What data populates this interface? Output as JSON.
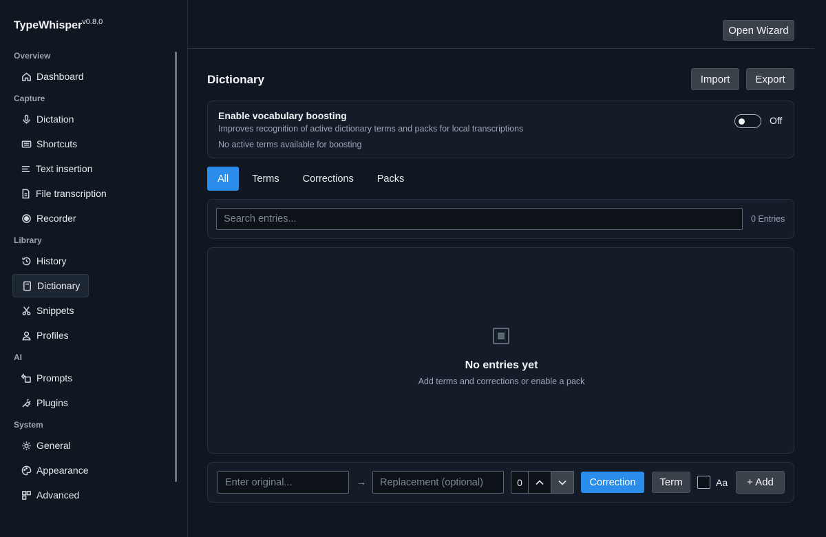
{
  "app": {
    "name": "TypeWhisper",
    "version": "v0.8.0"
  },
  "sidebar": {
    "sections": [
      {
        "label": "Overview",
        "items": [
          {
            "label": "Dashboard",
            "icon": "home-icon"
          }
        ]
      },
      {
        "label": "Capture",
        "items": [
          {
            "label": "Dictation",
            "icon": "microphone-icon"
          },
          {
            "label": "Shortcuts",
            "icon": "keyboard-icon"
          },
          {
            "label": "Text insertion",
            "icon": "text-lines-icon"
          },
          {
            "label": "File transcription",
            "icon": "file-icon"
          },
          {
            "label": "Recorder",
            "icon": "record-icon"
          }
        ]
      },
      {
        "label": "Library",
        "items": [
          {
            "label": "History",
            "icon": "history-icon"
          },
          {
            "label": "Dictionary",
            "icon": "book-icon",
            "active": true
          },
          {
            "label": "Snippets",
            "icon": "scissors-icon"
          },
          {
            "label": "Profiles",
            "icon": "user-icon"
          }
        ]
      },
      {
        "label": "AI",
        "items": [
          {
            "label": "Prompts",
            "icon": "prompt-icon"
          },
          {
            "label": "Plugins",
            "icon": "plug-icon"
          }
        ]
      },
      {
        "label": "System",
        "items": [
          {
            "label": "General",
            "icon": "gear-icon"
          },
          {
            "label": "Appearance",
            "icon": "palette-icon"
          },
          {
            "label": "Advanced",
            "icon": "advanced-icon"
          }
        ]
      }
    ]
  },
  "header": {
    "wizard_label": "Open Wizard"
  },
  "main": {
    "title": "Dictionary",
    "import_label": "Import",
    "export_label": "Export",
    "boost": {
      "title": "Enable vocabulary boosting",
      "description": "Improves recognition of active dictionary terms and packs for local transcriptions",
      "note": "No active terms available for boosting",
      "toggle_state": "Off"
    },
    "tabs": [
      {
        "label": "All",
        "active": true
      },
      {
        "label": "Terms"
      },
      {
        "label": "Corrections"
      },
      {
        "label": "Packs"
      }
    ],
    "search": {
      "placeholder": "Search entries...",
      "count": "0 Entries"
    },
    "empty": {
      "title": "No entries yet",
      "subtitle": "Add terms and corrections or enable a pack"
    },
    "add": {
      "original_placeholder": "Enter original...",
      "arrow": "→",
      "replacement_placeholder": "Replacement (optional)",
      "stepper_value": "0",
      "correction_label": "Correction",
      "term_label": "Term",
      "case_label": "Aa",
      "add_label": "+ Add"
    }
  },
  "colors": {
    "accent": "#2a8ceb",
    "background": "#101721",
    "panel": "#141c27"
  }
}
